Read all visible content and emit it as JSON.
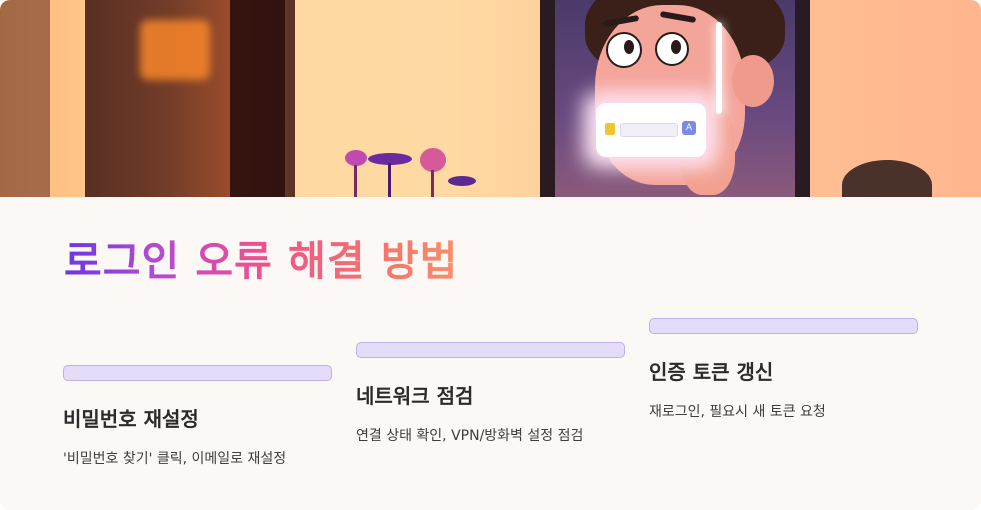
{
  "hero": {
    "illustration": "cartoon-person-holding-glowing-phone-login-screen",
    "phone_badge": "A"
  },
  "title": "로그인 오류 해결 방법",
  "steps": [
    {
      "title": "비밀번호 재설정",
      "description": "'비밀번호 찾기' 클릭, 이메일로 재설정"
    },
    {
      "title": "네트워크 점검",
      "description": "연결 상태 확인, VPN/방화벽 설정 점검"
    },
    {
      "title": "인증 토큰 갱신",
      "description": "재로그인, 필요시 새 토큰 요청"
    }
  ],
  "colors": {
    "title_gradient_start": "#6b36e0",
    "title_gradient_end": "#f8906a",
    "step_bar_fill": "#e4dcf8",
    "step_bar_border": "#bcb0e4",
    "background": "#fcf8f5"
  }
}
